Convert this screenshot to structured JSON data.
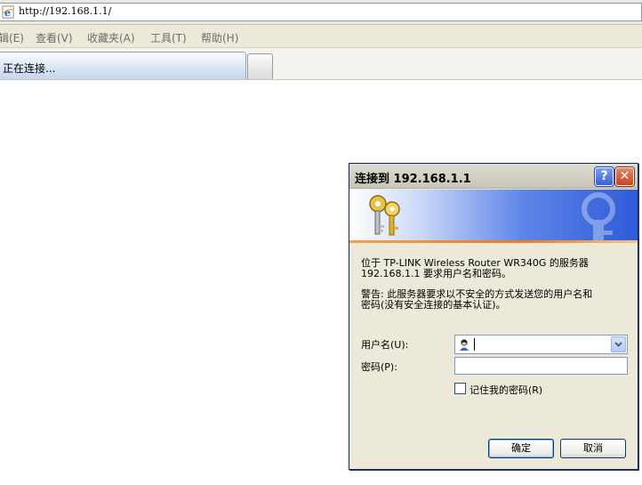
{
  "address_bar": {
    "url": "http://192.168.1.1/"
  },
  "menu": {
    "items": [
      {
        "label": "辑(E)"
      },
      {
        "label": "查看(V)"
      },
      {
        "label": "收藏夹(A)"
      },
      {
        "label": "工具(T)"
      },
      {
        "label": "帮助(H)"
      }
    ]
  },
  "tabs": {
    "active_label": "正在连接..."
  },
  "dialog": {
    "title": "连接到 192.168.1.1",
    "help_symbol": "?",
    "close_symbol": "✕",
    "message": "位于 TP-LINK Wireless Router WR340G 的服务器\n192.168.1.1 要求用户名和密码。",
    "warning": "警告: 此服务器要求以不安全的方式发送您的用户名和\n密码(没有安全连接的基本认证)。",
    "username_label": "用户名(U):",
    "password_label": "密码(P):",
    "username_value": "",
    "password_value": "",
    "remember_label": "记住我的密码(R)",
    "ok_label": "确定",
    "cancel_label": "取消"
  },
  "colors": {
    "banner_blue": "#2f5bd8",
    "banner_orange": "#f07a18",
    "title_close": "#c8431e"
  }
}
